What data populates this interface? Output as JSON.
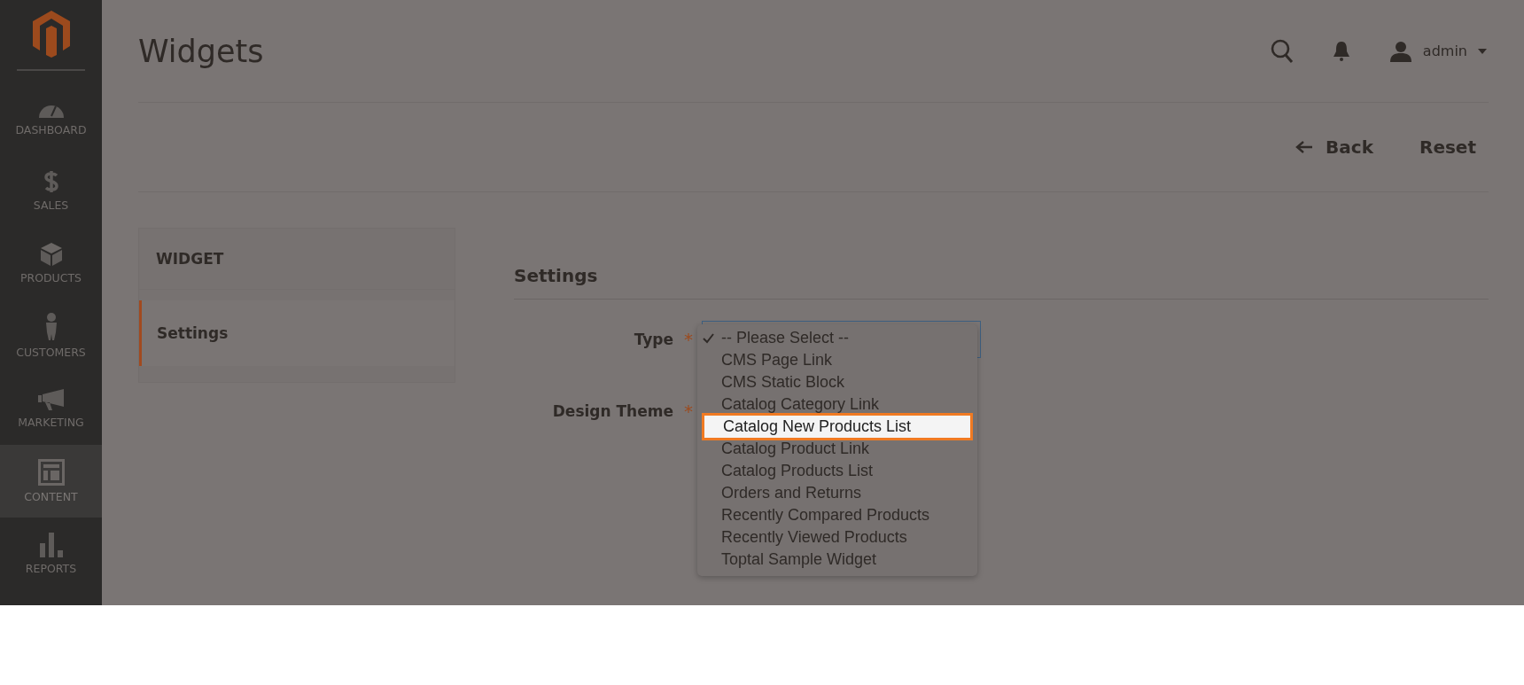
{
  "page_title": "Widgets",
  "header": {
    "user": "admin"
  },
  "sidebar": {
    "items": [
      {
        "label": "DASHBOARD",
        "kind": "gauge",
        "selected": false
      },
      {
        "label": "SALES",
        "kind": "dollar",
        "selected": false
      },
      {
        "label": "PRODUCTS",
        "kind": "box",
        "selected": false
      },
      {
        "label": "CUSTOMERS",
        "kind": "person",
        "selected": false
      },
      {
        "label": "MARKETING",
        "kind": "megaphone",
        "selected": false
      },
      {
        "label": "CONTENT",
        "kind": "layout",
        "selected": true
      },
      {
        "label": "REPORTS",
        "kind": "bars",
        "selected": false
      }
    ]
  },
  "actions": [
    {
      "label": "Back",
      "kind": "back"
    },
    {
      "label": "Reset",
      "kind": "plain"
    }
  ],
  "tabs": {
    "title": "WIDGET",
    "items": [
      {
        "label": "Settings",
        "selected": true
      }
    ]
  },
  "section_title": "Settings",
  "fields": [
    {
      "label": "Type",
      "required_mark": "*"
    },
    {
      "label": "Design Theme",
      "required_mark": "*"
    }
  ],
  "dropdown": {
    "options": [
      {
        "label": "-- Please Select --",
        "checked": true,
        "selected": false
      },
      {
        "label": "CMS Page Link",
        "checked": false,
        "selected": false
      },
      {
        "label": "CMS Static Block",
        "checked": false,
        "selected": false
      },
      {
        "label": "Catalog Category Link",
        "checked": false,
        "selected": false
      },
      {
        "label": "Catalog New Products List",
        "checked": false,
        "selected": true
      },
      {
        "label": "Catalog Product Link",
        "checked": false,
        "selected": false
      },
      {
        "label": "Catalog Products List",
        "checked": false,
        "selected": false
      },
      {
        "label": "Orders and Returns",
        "checked": false,
        "selected": false
      },
      {
        "label": "Recently Compared Products",
        "checked": false,
        "selected": false
      },
      {
        "label": "Recently Viewed Products",
        "checked": false,
        "selected": false
      },
      {
        "label": "Toptal Sample Widget",
        "checked": false,
        "selected": false
      }
    ]
  }
}
